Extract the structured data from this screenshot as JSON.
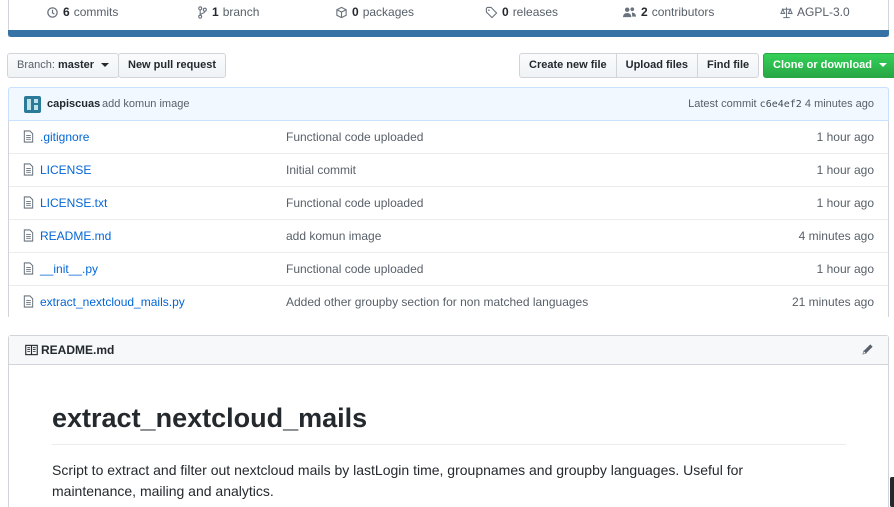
{
  "stats": {
    "commits": {
      "count": "6",
      "label": "commits"
    },
    "branch": {
      "count": "1",
      "label": "branch"
    },
    "packages": {
      "count": "0",
      "label": "packages"
    },
    "releases": {
      "count": "0",
      "label": "releases"
    },
    "contributors": {
      "count": "2",
      "label": "contributors"
    },
    "license": "AGPL-3.0"
  },
  "toolbar": {
    "branch_prefix": "Branch:",
    "branch_name": "master",
    "new_pr": "New pull request",
    "create_file": "Create new file",
    "upload_files": "Upload files",
    "find_file": "Find file",
    "clone": "Clone or download"
  },
  "latest_commit": {
    "author": "capiscuas",
    "message": "add komun image",
    "prefix": "Latest commit",
    "sha": "c6e4ef2",
    "age": "4 minutes ago"
  },
  "files": [
    {
      "name": ".gitignore",
      "message": "Functional code uploaded",
      "age": "1 hour ago"
    },
    {
      "name": "LICENSE",
      "message": "Initial commit",
      "age": "1 hour ago"
    },
    {
      "name": "LICENSE.txt",
      "message": "Functional code uploaded",
      "age": "1 hour ago"
    },
    {
      "name": "README.md",
      "message": "add komun image",
      "age": "4 minutes ago"
    },
    {
      "name": "__init__.py",
      "message": "Functional code uploaded",
      "age": "1 hour ago"
    },
    {
      "name": "extract_nextcloud_mails.py",
      "message": "Added other groupby section for non matched languages",
      "age": "21 minutes ago"
    }
  ],
  "readme": {
    "filename": "README.md",
    "heading": "extract_nextcloud_mails",
    "description": "Script to extract and filter out nextcloud mails by lastLogin time, groupnames and groupby languages. Useful for maintenance, mailing and analytics."
  },
  "colors": {
    "language_bar": "#3572a5",
    "link": "#0366d6",
    "clone_button": "#28a745"
  }
}
